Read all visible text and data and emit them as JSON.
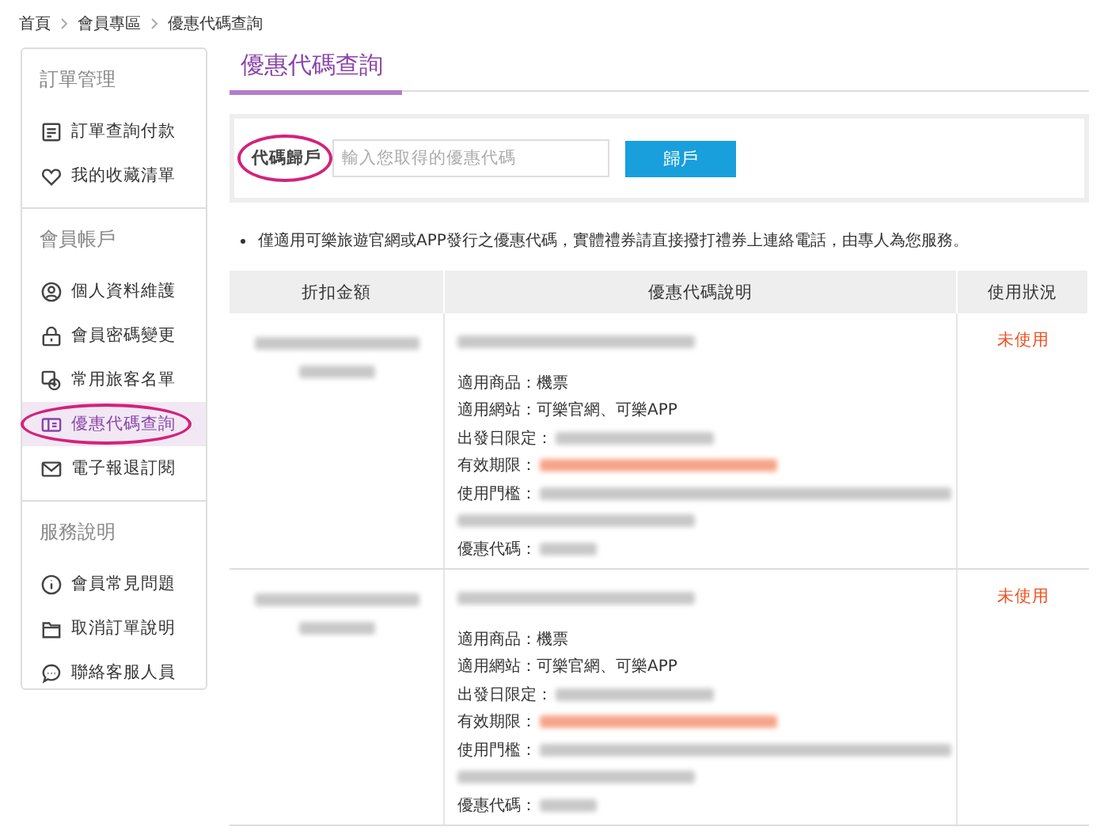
{
  "breadcrumb": [
    "首頁",
    "會員專區",
    "優惠代碼查詢"
  ],
  "sidebar": {
    "sections": [
      {
        "title": "訂單管理",
        "items": [
          {
            "label": "訂單查詢付款",
            "selected": false,
            "circled": false
          },
          {
            "label": "我的收藏清單",
            "selected": false,
            "circled": false
          }
        ]
      },
      {
        "title": "會員帳戶",
        "items": [
          {
            "label": "個人資料維護",
            "selected": false,
            "circled": false
          },
          {
            "label": "會員密碼變更",
            "selected": false,
            "circled": false
          },
          {
            "label": "常用旅客名單",
            "selected": false,
            "circled": false
          },
          {
            "label": "優惠代碼查詢",
            "selected": true,
            "circled": true
          },
          {
            "label": "電子報退訂閱",
            "selected": false,
            "circled": false
          }
        ]
      },
      {
        "title": "服務說明",
        "items": [
          {
            "label": "會員常見問題",
            "selected": false,
            "circled": false
          },
          {
            "label": "取消訂單說明",
            "selected": false,
            "circled": false
          },
          {
            "label": "聯絡客服人員",
            "selected": false,
            "circled": false
          }
        ]
      }
    ]
  },
  "page_title": "優惠代碼查詢",
  "code_form": {
    "label": "代碼歸戶",
    "label_circled": true,
    "placeholder": "輸入您取得的優惠代碼",
    "button": "歸戶"
  },
  "notes": [
    "僅適用可樂旅遊官網或APP發行之優惠代碼，實體禮券請直接撥打禮券上連絡電話，由專人為您服務。"
  ],
  "table": {
    "columns": [
      "折扣金額",
      "優惠代碼說明",
      "使用狀況"
    ],
    "rows": [
      {
        "status": "未使用",
        "details": [
          {
            "label": "適用商品：",
            "value": "機票",
            "kind": "plain"
          },
          {
            "label": "適用網站：",
            "value": "可樂官網、可樂APP",
            "kind": "plain"
          },
          {
            "label": "出發日限定：",
            "kind": "blurred"
          },
          {
            "label": "有效期限：",
            "kind": "blurred-alert"
          },
          {
            "label": "使用門檻：",
            "kind": "blurred-long"
          },
          {
            "label": "優惠代碼：",
            "kind": "blurred-short"
          }
        ]
      },
      {
        "status": "未使用",
        "details": [
          {
            "label": "適用商品：",
            "value": "機票",
            "kind": "plain"
          },
          {
            "label": "適用網站：",
            "value": "可樂官網、可樂APP",
            "kind": "plain"
          },
          {
            "label": "出發日限定：",
            "kind": "blurred"
          },
          {
            "label": "有效期限：",
            "kind": "blurred-alert"
          },
          {
            "label": "使用門檻：",
            "kind": "blurred-long"
          },
          {
            "label": "優惠代碼：",
            "kind": "blurred-short"
          }
        ]
      }
    ]
  }
}
